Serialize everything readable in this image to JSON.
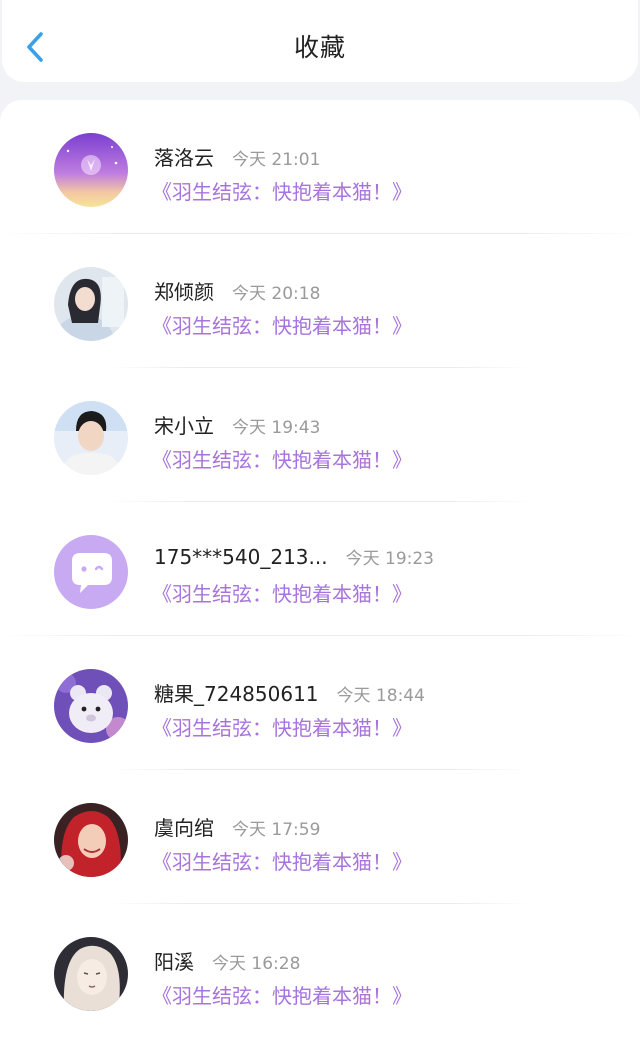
{
  "header": {
    "title": "收藏",
    "back_icon": "chevron-left-icon",
    "accent_color": "#3aa0e8"
  },
  "favorites": [
    {
      "name": "落洛云",
      "time": "今天 21:01",
      "title": "《羽生结弦：快抱着本猫！》",
      "avatar": "purple-sky-avatar"
    },
    {
      "name": "郑倾颜",
      "time": "今天 20:18",
      "title": "《羽生结弦：快抱着本猫！》",
      "avatar": "girl-photo-avatar"
    },
    {
      "name": "宋小立",
      "time": "今天 19:43",
      "title": "《羽生结弦：快抱着本猫！》",
      "avatar": "boy-photo-avatar"
    },
    {
      "name": "175***540_213...",
      "time": "今天 19:23",
      "title": "《羽生结弦：快抱着本猫！》",
      "avatar": "default-chat-avatar"
    },
    {
      "name": "糖果_724850611",
      "time": "今天 18:44",
      "title": "《羽生结弦：快抱着本猫！》",
      "avatar": "teddy-bear-avatar"
    },
    {
      "name": "虞向绾",
      "time": "今天 17:59",
      "title": "《羽生结弦：快抱着本猫！》",
      "avatar": "red-hair-girl-avatar"
    },
    {
      "name": "阳溪",
      "time": "今天 16:28",
      "title": "《羽生结弦：快抱着本猫！》",
      "avatar": "anime-girl-avatar"
    }
  ],
  "colors": {
    "link_purple": "#a774dd",
    "time_gray": "#9a9a9a",
    "background": "#f2f3f7"
  }
}
